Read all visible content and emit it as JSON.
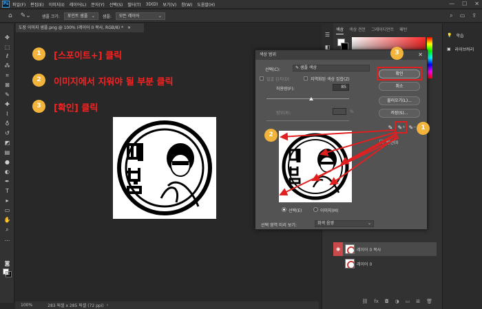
{
  "menubar": {
    "logo": "Ps",
    "items": [
      "파일(F)",
      "편집(E)",
      "이미지(I)",
      "레이어(L)",
      "문자(Y)",
      "선택(S)",
      "필터(T)",
      "3D(D)",
      "보기(V)",
      "창(W)",
      "도움말(H)"
    ],
    "window_controls": [
      "—",
      "☐",
      "✕"
    ]
  },
  "options_bar": {
    "sample_size_label": "샘플 크기:",
    "sample_size_value": "포인트 샘플",
    "sample_label": "샘플:",
    "sample_value": "모든 레이어"
  },
  "document": {
    "tab_title": "도장 이미지 샘플.png @ 100% (레이어 0 복사, RGB/8) *",
    "close": "✕"
  },
  "status_bar": {
    "zoom": "100%",
    "info": "283 픽셀 x 285 픽셀 (72 ppi)",
    "arrow": "›"
  },
  "steps": [
    {
      "num": "1",
      "text": "[스포이트+] 클릭"
    },
    {
      "num": "2",
      "text": "이미지에서 지워야 될 부분 클릭"
    },
    {
      "num": "3",
      "text": "[확인] 클릭"
    }
  ],
  "dialog": {
    "title": "색상 범위",
    "select_label": "선택(C):",
    "select_value": "샘플 색상",
    "detect_faces": "얼굴 감지(D)",
    "localized": "지역화된 색상 집합(Z)",
    "fuzziness_label": "허용량(F):",
    "fuzziness_value": "85",
    "range_label": "범위(R):",
    "range_unit": "%",
    "radio_selection": "선택(E)",
    "radio_image": "이미지(M)",
    "preview_label": "선택 영역 미리 보기:",
    "preview_value": "회색 음영",
    "buttons": {
      "ok": "확인",
      "cancel": "취소",
      "load": "불러오기(L)...",
      "save": "저장(S)..."
    },
    "invert": "반전(I)"
  },
  "right_panels": {
    "color_tabs": [
      "색상",
      "색상 견본",
      "그레이디언트",
      "패턴"
    ],
    "layers": [
      {
        "name": "레이어 0 복사",
        "active": true
      },
      {
        "name": "레이어 0",
        "active": false
      }
    ]
  },
  "far_right": {
    "learn": "학습",
    "library": "라이브러리"
  },
  "colors": {
    "accent_red": "#e02020",
    "step_badge": "#f2b43a",
    "step_text": "#ff2020"
  }
}
